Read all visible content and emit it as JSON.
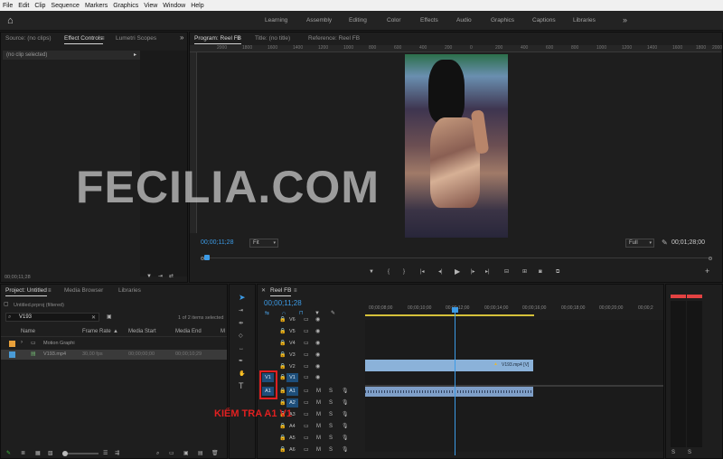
{
  "menu": [
    "File",
    "Edit",
    "Clip",
    "Sequence",
    "Markers",
    "Graphics",
    "View",
    "Window",
    "Help"
  ],
  "workspaces": [
    "Learning",
    "Assembly",
    "Editing",
    "Color",
    "Effects",
    "Audio",
    "Graphics",
    "Captions",
    "Libraries"
  ],
  "source_panel": {
    "tabs": [
      "Source: (no clips)",
      "Effect Controls",
      "Lumetri Scopes"
    ],
    "no_clip": "(no clip selected)",
    "timecode": "00;00;11;28"
  },
  "program": {
    "tabs": [
      "Program: Reel FB",
      "Title: (no title)",
      "Reference: Reel FB"
    ],
    "ruler_labels": [
      "2000",
      "1800",
      "1600",
      "1400",
      "1200",
      "1000",
      "800",
      "600",
      "400",
      "200",
      "0",
      "200",
      "400",
      "600",
      "800",
      "1000",
      "1200",
      "1400",
      "1600",
      "1800",
      "2000"
    ],
    "current_time": "00;00;11;28",
    "fit": "Fit",
    "full": "Full",
    "duration": "00;01;28;00"
  },
  "project": {
    "tabs": [
      "Project: Untitled",
      "Media Browser",
      "Libraries"
    ],
    "file": "Untitled.prproj (filtered)",
    "search_value": "V193",
    "items_selected": "1 of 2 items selected",
    "columns": [
      "Name",
      "Frame Rate",
      "Media Start",
      "Media End",
      "M"
    ],
    "rows": [
      {
        "name": "Motion Graphi",
        "fps": "",
        "start": "",
        "end": "",
        "color": "#e8a03a"
      },
      {
        "name": "V193.mp4",
        "fps": "30,00 fps",
        "start": "00;00;00;00",
        "end": "00;00;10;29",
        "color": "#4a9bd6"
      }
    ]
  },
  "timeline": {
    "tab": "Reel FB",
    "timecode": "00;00;11;28",
    "ticks": [
      "00;00;08;00",
      "00;00;10;00",
      "00;00;12;00",
      "00;00;14;00",
      "00;00;16;00",
      "00;00;18;00",
      "00;00;20;00",
      "00;00;2"
    ],
    "video_tracks": [
      "V6",
      "V5",
      "V4",
      "V3",
      "V2",
      "V1"
    ],
    "audio_tracks": [
      "A1",
      "A2",
      "A3",
      "A4",
      "A5",
      "A6"
    ],
    "source_patch_v": "V1",
    "source_patch_a": "A1",
    "clip_video": "V193.mp4 [V]",
    "annotation": "KIỂM TRA A1 V1"
  },
  "watermark": "FECILIA.COM"
}
